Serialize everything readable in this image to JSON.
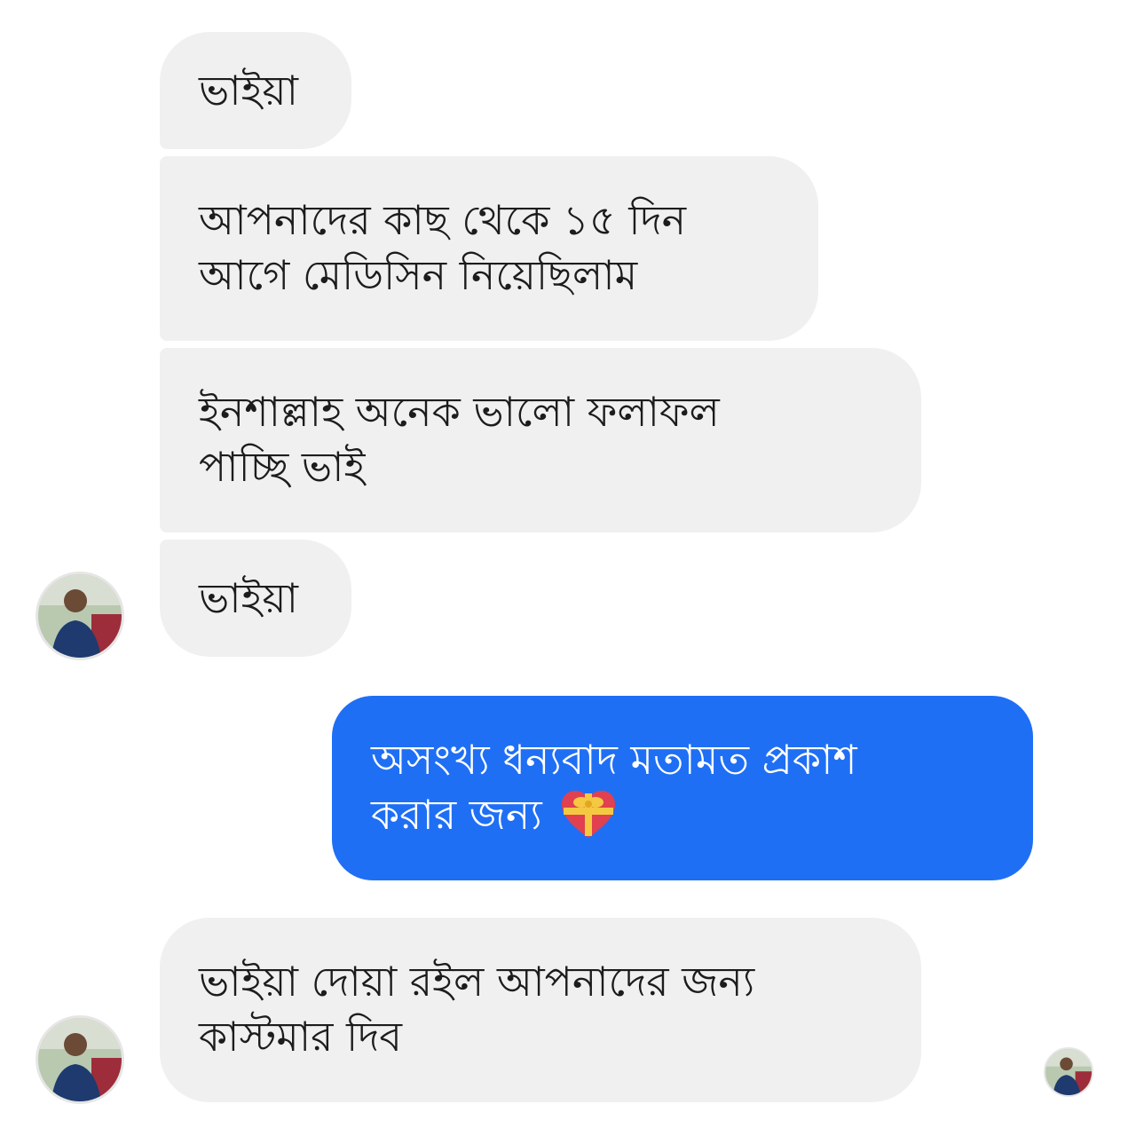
{
  "messages": [
    {
      "id": "m1",
      "direction": "incoming",
      "lines": [
        "ভাইয়া"
      ]
    },
    {
      "id": "m2",
      "direction": "incoming",
      "lines": [
        "আপনাদের কাছ থেকে ১৫ দিন",
        "আগে  মেডিসিন নিয়েছিলাম"
      ]
    },
    {
      "id": "m3",
      "direction": "incoming",
      "lines": [
        "ইনশাল্লাহ অনেক ভালো ফলাফল",
        "পাচ্ছি ভাই"
      ]
    },
    {
      "id": "m4",
      "direction": "incoming",
      "lines": [
        "ভাইয়া"
      ]
    },
    {
      "id": "m5",
      "direction": "outgoing",
      "lines": [
        "অসংখ্য ধন্যবাদ মতামত প্রকাশ",
        "করার জন্য"
      ],
      "emoji": "heart-with-ribbon-icon"
    },
    {
      "id": "m6",
      "direction": "incoming",
      "lines": [
        "ভাইয়া দোয়া রইল আপনাদের জন্য",
        "কাস্টমার দিব"
      ]
    }
  ],
  "colors": {
    "incoming_bubble": "#f0f0f0",
    "outgoing_bubble": "#1f6ff5",
    "incoming_text": "#1c1c1c",
    "outgoing_text": "#ffffff"
  },
  "icons": {
    "sender_avatar": "sender-avatar-icon",
    "seen_avatar": "seen-receipt-avatar-icon"
  }
}
